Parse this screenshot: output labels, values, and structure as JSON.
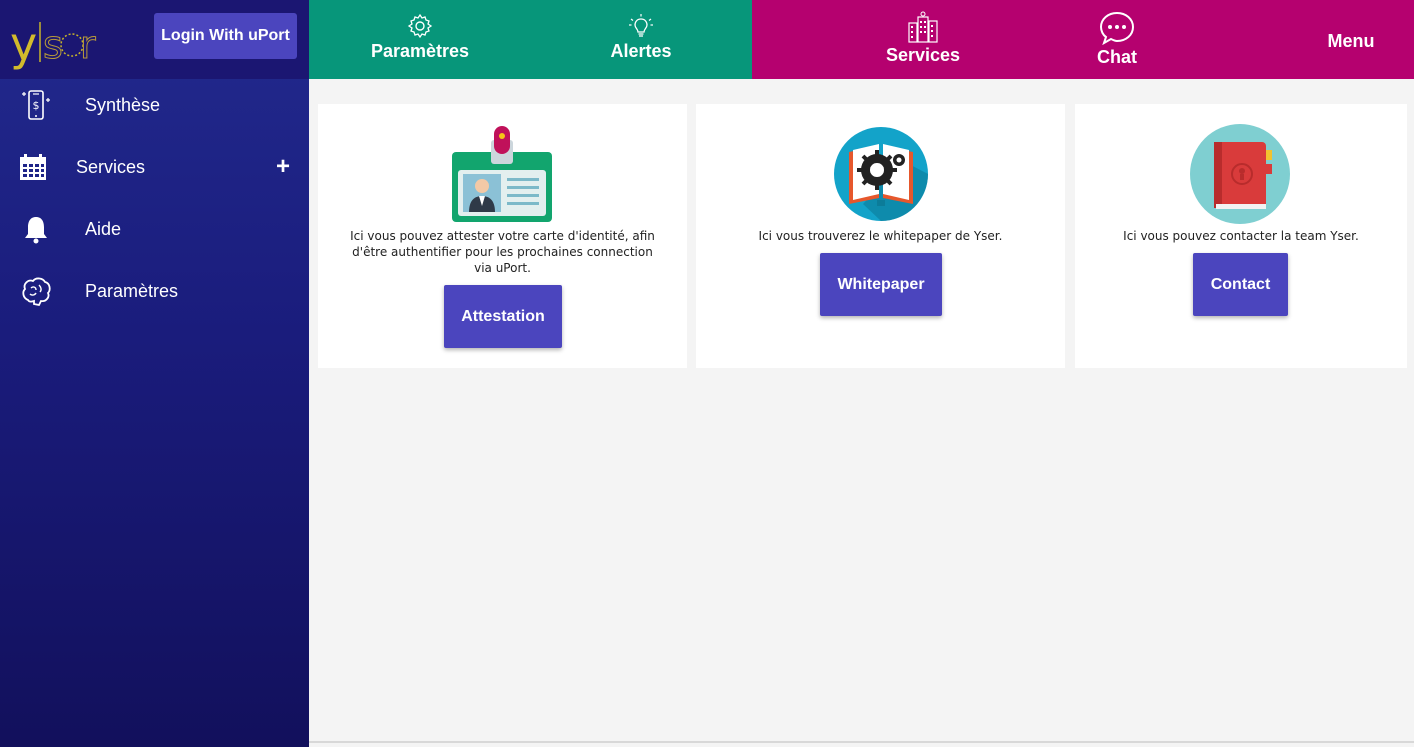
{
  "logo": {
    "text": "yser",
    "tagline": ""
  },
  "header": {
    "login_label": "Login With uPort"
  },
  "sidebar": {
    "items": [
      {
        "label": "Synthèse",
        "icon": "phone-dollar-icon"
      },
      {
        "label": "Services",
        "icon": "calendar-icon",
        "expand": "+"
      },
      {
        "label": "Aide",
        "icon": "bell-icon"
      },
      {
        "label": "Paramètres",
        "icon": "brain-icon"
      }
    ]
  },
  "topbar": {
    "tabs": [
      {
        "label": "Paramètres",
        "icon": "gear-icon"
      },
      {
        "label": "Alertes",
        "icon": "lightbulb-icon"
      },
      {
        "label": "Services",
        "icon": "building-icon"
      },
      {
        "label": "Chat",
        "icon": "chat-bubble-icon"
      },
      {
        "label": "Menu"
      }
    ],
    "colors": {
      "left": "#07967a",
      "right": "#b5016f"
    }
  },
  "cards": [
    {
      "description": "Ici vous pouvez attester votre carte d'identité, afin d'être authentifier pour les prochaines connection via uPort.",
      "button": "Attestation",
      "icon": "id-badge-icon"
    },
    {
      "description": "Ici vous trouverez le whitepaper de Yser.",
      "button": "Whitepaper",
      "icon": "book-gear-icon"
    },
    {
      "description": "Ici vous pouvez contacter la team Yser.",
      "button": "Contact",
      "icon": "address-book-icon"
    }
  ],
  "colors": {
    "sidebar": "#1a1c7c",
    "button": "#4b45be",
    "background": "#f4f4f4"
  }
}
